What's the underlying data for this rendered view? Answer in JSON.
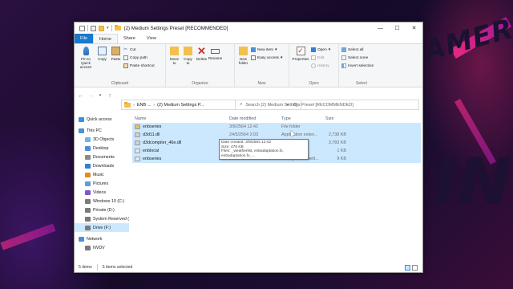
{
  "window": {
    "title": "(2) Medium Settings Preset [RECOMMENDED]",
    "minimize": "—",
    "maximize": "☐",
    "close": "✕"
  },
  "ribbon_tabs": [
    "File",
    "Home",
    "Share",
    "View"
  ],
  "ribbon": {
    "clipboard": {
      "label": "Clipboard",
      "pin": "Pin to Quick access",
      "copy": "Copy",
      "paste": "Paste",
      "cut": "Cut",
      "copy_path": "Copy path",
      "paste_shortcut": "Paste shortcut"
    },
    "organize": {
      "label": "Organize",
      "move_to": "Move to",
      "copy_to": "Copy to",
      "delete": "Delete",
      "rename": "Rename"
    },
    "new": {
      "label": "New",
      "new_folder": "New folder",
      "new_item": "New item",
      "easy_access": "Easy access"
    },
    "open": {
      "label": "Open",
      "properties": "Properties",
      "open": "Open",
      "edit": "Edit",
      "history": "History"
    },
    "select": {
      "label": "Select",
      "select_all": "Select all",
      "select_none": "Select none",
      "invert": "Invert selection"
    }
  },
  "address": {
    "crumbs": [
      "ENB ...",
      "(2) Medium Settings P..."
    ],
    "search_placeholder": "Search (2) Medium Settings Preset [RECOMMENDED]"
  },
  "nav": [
    {
      "label": "Quick access",
      "color": "#3b8ee8"
    },
    {
      "label": "This PC",
      "color": "#4a90d9"
    },
    {
      "label": "3D Objects",
      "color": "#6fb7e8"
    },
    {
      "label": "Desktop",
      "color": "#4a90d9"
    },
    {
      "label": "Documents",
      "color": "#8a8a8a"
    },
    {
      "label": "Downloads",
      "color": "#2f7fd6"
    },
    {
      "label": "Music",
      "color": "#e08a2a"
    },
    {
      "label": "Pictures",
      "color": "#5aa0e0"
    },
    {
      "label": "Videos",
      "color": "#7a5ac8"
    },
    {
      "label": "Windows 10 (C:)",
      "color": "#7a7a7a"
    },
    {
      "label": "Private (D:)",
      "color": "#7a7a7a"
    },
    {
      "label": "System Reserved (",
      "color": "#7a7a7a"
    },
    {
      "label": "Drive (F:)",
      "color": "#7a7a7a"
    },
    {
      "label": "Network",
      "color": "#4a90d9"
    },
    {
      "label": "NVDV",
      "color": "#7a7a7a"
    }
  ],
  "columns": {
    "name": "Name",
    "date": "Date modified",
    "type": "Type",
    "size": "Size"
  },
  "files": [
    {
      "name": "enbseries",
      "date": "3/9/2564 12:42",
      "type": "File folder",
      "size": "",
      "color": "#f3c04b"
    },
    {
      "name": "d3d11.dll",
      "date": "24/5/2564 2:03",
      "type": "Application exten...",
      "size": "2,738 KB",
      "color": "#d0d0d0"
    },
    {
      "name": "d3dcompiler_46e.dll",
      "date": "",
      "type": "",
      "size": "3,783 KB",
      "color": "#d0d0d0"
    },
    {
      "name": "enblocal",
      "date": "",
      "type": "",
      "size": "1 KB",
      "color": "#e8e8e8"
    },
    {
      "name": "enbseries",
      "date": "23/4/2564 3:07",
      "type": "Configuration sett...",
      "size": "9 KB",
      "color": "#e8e8e8"
    }
  ],
  "tooltip": {
    "created": "Date created: 3/9/2564 12:42",
    "size": "Size: 476 KB",
    "files": "Files: _weatherlist, enbadaptation.fx, enbadaptation.fx, ..."
  },
  "status": {
    "items": "5 items",
    "selected": "5 items selected"
  }
}
